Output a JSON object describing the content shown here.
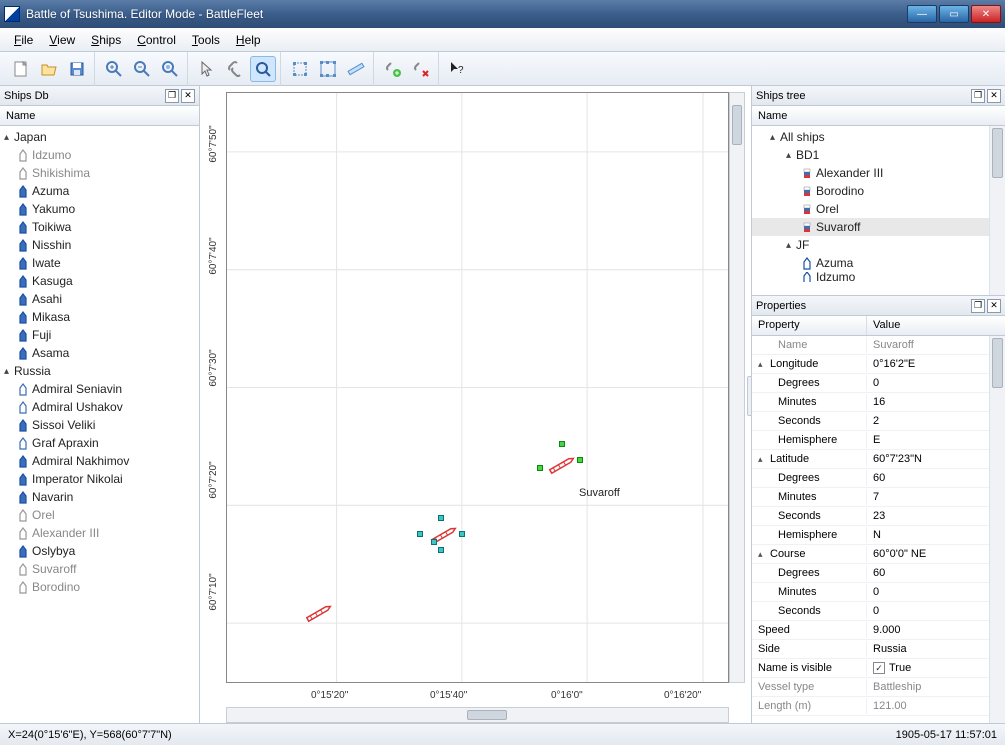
{
  "title": "Battle of Tsushima. Editor Mode - BattleFleet",
  "menu": [
    "File",
    "View",
    "Ships",
    "Control",
    "Tools",
    "Help"
  ],
  "shipsDb": {
    "title": "Ships Db",
    "colHeader": "Name",
    "groups": [
      {
        "name": "Japan",
        "ships": [
          {
            "name": "Idzumo",
            "color": "gray"
          },
          {
            "name": "Shikishima",
            "color": "gray"
          },
          {
            "name": "Azuma",
            "color": "blue"
          },
          {
            "name": "Yakumo",
            "color": "blue"
          },
          {
            "name": "Toikiwa",
            "color": "blue"
          },
          {
            "name": "Nisshin",
            "color": "blue"
          },
          {
            "name": "Iwate",
            "color": "blue"
          },
          {
            "name": "Kasuga",
            "color": "blue"
          },
          {
            "name": "Asahi",
            "color": "blue"
          },
          {
            "name": "Mikasa",
            "color": "blue"
          },
          {
            "name": "Fuji",
            "color": "blue"
          },
          {
            "name": "Asama",
            "color": "blue"
          }
        ]
      },
      {
        "name": "Russia",
        "ships": [
          {
            "name": "Admiral Seniavin",
            "color": "blue-outline"
          },
          {
            "name": "Admiral Ushakov",
            "color": "blue-outline"
          },
          {
            "name": "Sissoi Veliki",
            "color": "blue"
          },
          {
            "name": "Graf Apraxin",
            "color": "blue-outline"
          },
          {
            "name": "Admiral Nakhimov",
            "color": "blue"
          },
          {
            "name": "Imperator Nikolai",
            "color": "blue"
          },
          {
            "name": "Navarin",
            "color": "blue"
          },
          {
            "name": "Orel",
            "color": "gray"
          },
          {
            "name": "Alexander III",
            "color": "gray"
          },
          {
            "name": "Oslybya",
            "color": "blue"
          },
          {
            "name": "Suvaroff",
            "color": "gray"
          },
          {
            "name": "Borodino",
            "color": "gray"
          }
        ]
      }
    ]
  },
  "shipsTree": {
    "title": "Ships tree",
    "colHeader": "Name",
    "root": "All ships",
    "groups": [
      {
        "name": "BD1",
        "ships": [
          {
            "name": "Alexander III",
            "flag": "ru"
          },
          {
            "name": "Borodino",
            "flag": "ru"
          },
          {
            "name": "Orel",
            "flag": "ru"
          },
          {
            "name": "Suvaroff",
            "flag": "ru",
            "selected": true
          }
        ]
      },
      {
        "name": "JF",
        "ships": [
          {
            "name": "Azuma",
            "flag": "jp"
          },
          {
            "name": "Idzumo",
            "flag": "jp"
          }
        ]
      }
    ]
  },
  "properties": {
    "title": "Properties",
    "headers": {
      "prop": "Property",
      "val": "Value"
    },
    "rows": [
      {
        "label": "Name",
        "value": "Suvaroff",
        "sub": true,
        "dim": true
      },
      {
        "label": "Longitude",
        "value": "0°16'2\"E",
        "group": true
      },
      {
        "label": "Degrees",
        "value": "0",
        "sub": true
      },
      {
        "label": "Minutes",
        "value": "16",
        "sub": true
      },
      {
        "label": "Seconds",
        "value": "2",
        "sub": true
      },
      {
        "label": "Hemisphere",
        "value": "E",
        "sub": true
      },
      {
        "label": "Latitude",
        "value": "60°7'23\"N",
        "group": true
      },
      {
        "label": "Degrees",
        "value": "60",
        "sub": true
      },
      {
        "label": "Minutes",
        "value": "7",
        "sub": true
      },
      {
        "label": "Seconds",
        "value": "23",
        "sub": true
      },
      {
        "label": "Hemisphere",
        "value": "N",
        "sub": true
      },
      {
        "label": "Course",
        "value": "60°0'0\" NE",
        "group": true
      },
      {
        "label": "Degrees",
        "value": "60",
        "sub": true
      },
      {
        "label": "Minutes",
        "value": "0",
        "sub": true
      },
      {
        "label": "Seconds",
        "value": "0",
        "sub": true
      },
      {
        "label": "Speed",
        "value": "9.000"
      },
      {
        "label": "Side",
        "value": "Russia"
      },
      {
        "label": "Name is visible",
        "value": "True",
        "checkbox": true
      },
      {
        "label": "Vessel type",
        "value": "Battleship",
        "dim": true
      },
      {
        "label": "Length (m)",
        "value": "121.00",
        "dim": true
      }
    ]
  },
  "map": {
    "yTicks": [
      "60°7'50\"",
      "60°7'40\"",
      "60°7'30\"",
      "60°7'20\"",
      "60°7'10\""
    ],
    "xTicks": [
      "0°15'20\"",
      "0°15'40\"",
      "0°16'0\"",
      "0°16'20\""
    ],
    "shipLabel": "Suvaroff"
  },
  "status": {
    "coords": "X=24(0°15'6\"E), Y=568(60°7'7\"N)",
    "time": "1905-05-17 11:57:01"
  }
}
